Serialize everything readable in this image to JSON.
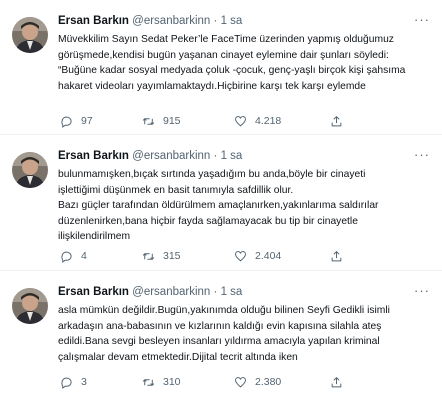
{
  "colors": {
    "text": "#0f1419",
    "secondary": "#536471",
    "separator": "#eff3f4"
  },
  "icons": {
    "reply": "reply-icon",
    "retweet": "retweet-icon",
    "like": "heart-icon",
    "share": "share-icon",
    "more": "more-icon"
  },
  "tweets": [
    {
      "author": {
        "name": "Ersan Barkın",
        "handle": "@ersanbarkinn"
      },
      "dot": "·",
      "time": "1 sa",
      "more": "···",
      "lines": [
        "Müvekkilim Sayın Sedat Peker’le FaceTime üzerinden yapmış olduğumuz",
        "görüşmede,kendisi bugün yaşanan cinayet eylemine dair şunları söyledi:",
        "“Buğüne kadar sosyal medyada çoluk -çocuk, genç-yaşlı birçok kişi şahsıma",
        "hakaret videoları yayımlamaktaydı.Hiçbirine karşı tek karşı eylemde"
      ],
      "stats": {
        "replies": "97",
        "retweets": "915",
        "likes": "4.218"
      }
    },
    {
      "author": {
        "name": "Ersan Barkın",
        "handle": "@ersanbarkinn"
      },
      "dot": "·",
      "time": "1 sa",
      "more": "···",
      "lines": [
        "bulunmamışken,bıçak sırtında yaşadığım bu anda,böyle bir cinayeti",
        "işlettiğimi düşünmek en basit tanımıyla safdillik olur.",
        "Bazı güçler tarafından öldürülmem amaçlanırken,yakınlarıma saldırılar",
        "düzenlenirken,bana hiçbir fayda sağlamayacak bu tip bir cinayetle",
        "ilişkilendirilmem"
      ],
      "stats": {
        "replies": "4",
        "retweets": "315",
        "likes": "2.404"
      }
    },
    {
      "author": {
        "name": "Ersan Barkın",
        "handle": "@ersanbarkinn"
      },
      "dot": "·",
      "time": "1 sa",
      "more": "···",
      "lines": [
        "asla mümkün değildir.Bugün,yakınımda olduğu bilinen Seyfi Gedikli isimli",
        "arkadaşın ana-babasının ve kızlarının kaldığı evin kapısına silahla ateş",
        "edildi.Bana sevgi besleyen insanları yıldırma amacıyla yapılan kriminal",
        "çalışmalar devam etmektedir.Dijital tecrit altında iken"
      ],
      "stats": {
        "replies": "3",
        "retweets": "310",
        "likes": "2.380"
      }
    }
  ]
}
